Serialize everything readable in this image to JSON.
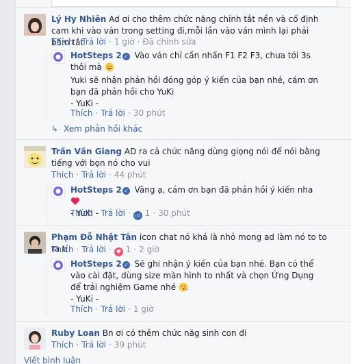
{
  "comments": [
    {
      "name": "Lý Hy Nhiên",
      "text": "Ad ơi cho thêm chức năng chỉnh tắt nền và cố định cam khi vào ván trong setting đi,mỗi lần vào ván mình lại phải bấm tắt",
      "like": "Thích",
      "reply": "Trả lời",
      "time": "1 giờ",
      "edited": "Đã chỉnh sửa",
      "replies": [
        {
          "name": "HotSteps 2",
          "line1": "Vào ván chỉ cần nhấn F1 F2 F3, chưa tới 3s thôi mà",
          "line2": "Yuki sẽ nhận phản hồi đóng góp ý kiến của bạn nhé, cám ơn bạn đã phản hồi cho YuKi",
          "sign": "- YuKi -",
          "like": "Thích",
          "reply": "Trả lời",
          "time": "30 phút"
        }
      ],
      "more_replies": "Xem phản hồi khác"
    },
    {
      "name": "Trần Văn Giang",
      "text": "AD ra cả chức năng dùng giọng nói để nói bằng tiếng với bọn nó cho vui",
      "like": "Thích",
      "reply": "Trả lời",
      "time": "44 phút",
      "replies": [
        {
          "name": "HotSteps 2",
          "line1": "Vâng ạ, cám ơn bạn đã phản hồi ý kiến nha",
          "sign": "- YuKi -",
          "like": "Thích",
          "reply": "Trả lời",
          "reactions": "1",
          "time": "30 phút"
        }
      ]
    },
    {
      "name": "Phạm Đỗ Nhật Tân",
      "text": "icon chat nó khá là nhỏ mong ad làm nó to to ra tí",
      "like": "Thích",
      "reply": "Trả lời",
      "reactions": "1",
      "time": "2 giờ",
      "replies": [
        {
          "name": "HotSteps 2",
          "line1": "Sẽ ghi nhận ý kiến của bạn nhé. Bạn có thể vào cài đặt, dùng size màn hình to nhất và chọn Ứng Dụng để trải nghiệm Game nhé",
          "sign": "- YuKi -",
          "like": "Thích",
          "reply": "Trả lời",
          "time": "1 giờ"
        }
      ]
    },
    {
      "name": "Ruby Loan",
      "text": "Bn ơi có thêm chức năg sinh con đi",
      "like": "Thích",
      "reply": "Trả lời",
      "time": "39 phút"
    }
  ],
  "write_comment": "Viết bình luận",
  "colors": {
    "link": "#365899",
    "action": "#4267b2",
    "meta": "#90949c",
    "panel": "#f6f7f9"
  },
  "icons": {
    "emoji": "grinning-emoji-icon",
    "heart": "red-heart-icon",
    "kiss": "kissing-emoji-icon",
    "arrow": "reply-arrow-icon",
    "verified": "verified-badge-icon",
    "like": "like-reaction-icon",
    "love": "love-reaction-icon"
  }
}
